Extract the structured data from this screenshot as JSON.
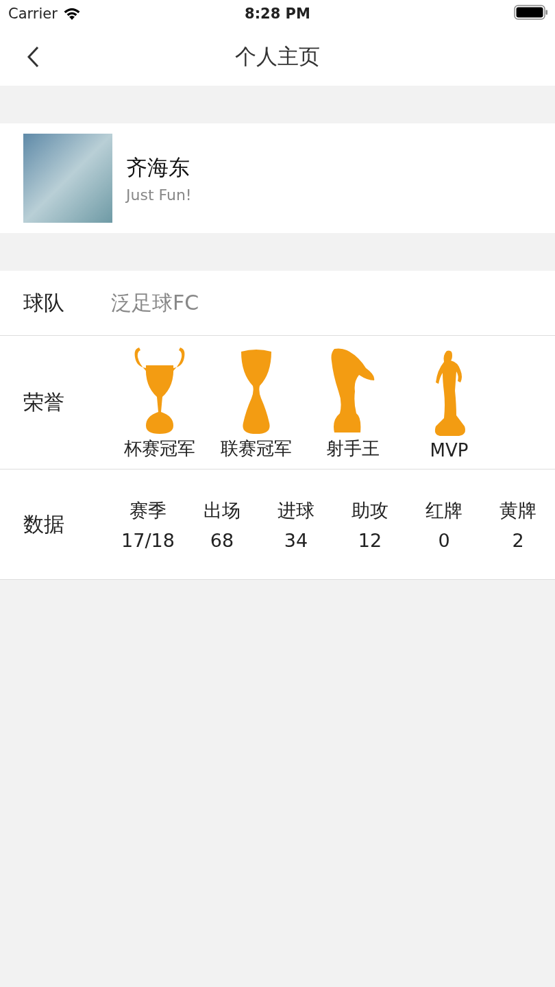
{
  "status_bar": {
    "carrier": "Carrier",
    "time": "8:28 PM"
  },
  "nav": {
    "title": "个人主页"
  },
  "profile": {
    "name": "齐海东",
    "motto": "Just Fun!"
  },
  "team": {
    "label": "球队",
    "value": "泛足球FC"
  },
  "honors": {
    "label": "荣誉",
    "items": [
      {
        "kind": "cup",
        "label": "杯赛冠军"
      },
      {
        "kind": "league",
        "label": "联赛冠军"
      },
      {
        "kind": "boot",
        "label": "射手王"
      },
      {
        "kind": "player",
        "label": "MVP"
      }
    ]
  },
  "stats": {
    "label": "数据",
    "columns": [
      {
        "heading": "赛季",
        "value": "17/18"
      },
      {
        "heading": "出场",
        "value": "68"
      },
      {
        "heading": "进球",
        "value": "34"
      },
      {
        "heading": "助攻",
        "value": "12"
      },
      {
        "heading": "红牌",
        "value": "0"
      },
      {
        "heading": "黄牌",
        "value": "2"
      }
    ]
  }
}
